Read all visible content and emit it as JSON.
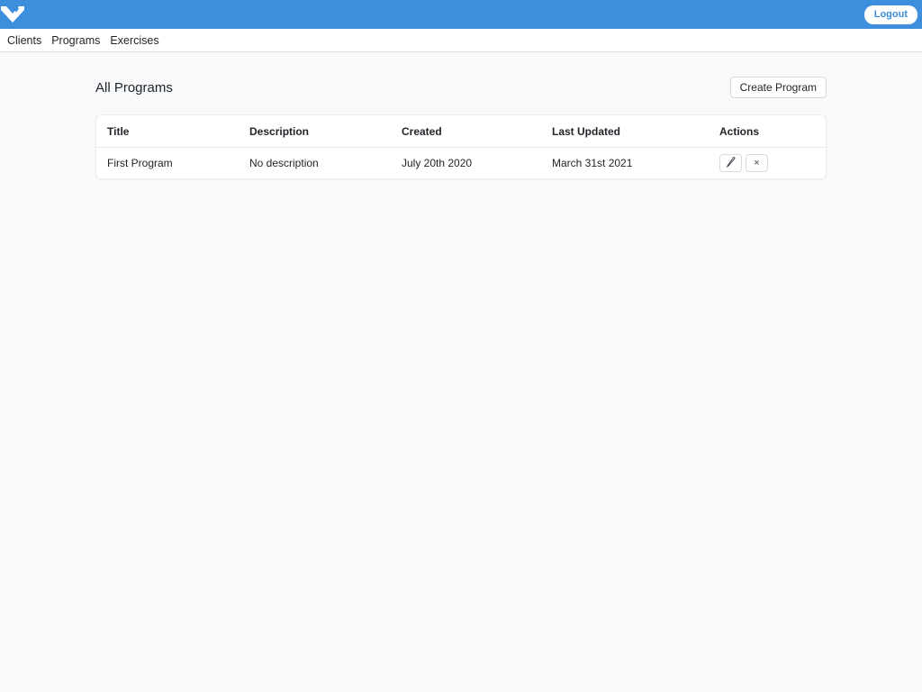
{
  "colors": {
    "brand_blue": "#3E8EDE",
    "page_background": "#F8F9FA",
    "card_background": "#FFFFFF",
    "text": "#212529",
    "divider": "#DEE2E6"
  },
  "header": {
    "logo_icon": "brand-m-logo",
    "logout_button": "Logout"
  },
  "nav": {
    "items": [
      "Clients",
      "Programs",
      "Exercises"
    ]
  },
  "main": {
    "title": "All Programs",
    "create_button": "Create Program",
    "table": {
      "columns": [
        "Title",
        "Description",
        "Created",
        "Last Updated",
        "Actions"
      ],
      "rows": [
        {
          "title": "First Program",
          "description": "No description",
          "created": "July 20th 2020",
          "last_updated": "March 31st 2021",
          "actions": {
            "edit_icon": "pencil",
            "delete_icon": "×"
          }
        }
      ]
    }
  }
}
